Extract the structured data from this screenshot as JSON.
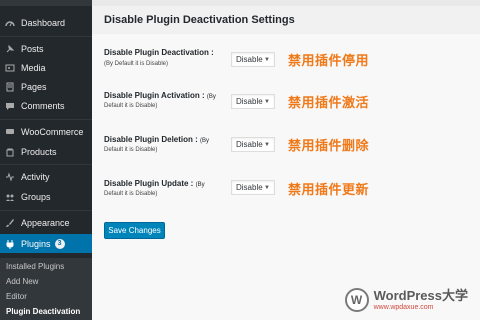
{
  "sidebar": {
    "items": [
      {
        "label": "Dashboard",
        "icon": "dashboard-icon"
      },
      {
        "label": "Posts",
        "icon": "pin-icon"
      },
      {
        "label": "Media",
        "icon": "media-icon"
      },
      {
        "label": "Pages",
        "icon": "page-icon"
      },
      {
        "label": "Comments",
        "icon": "comment-icon"
      },
      {
        "label": "WooCommerce",
        "icon": "woocommerce-icon"
      },
      {
        "label": "Products",
        "icon": "products-icon"
      },
      {
        "label": "Activity",
        "icon": "activity-icon"
      },
      {
        "label": "Groups",
        "icon": "groups-icon"
      },
      {
        "label": "Appearance",
        "icon": "brush-icon"
      },
      {
        "label": "Plugins",
        "icon": "plug-icon",
        "badge": "3"
      }
    ],
    "submenu": [
      {
        "label": "Installed Plugins"
      },
      {
        "label": "Add New"
      },
      {
        "label": "Editor"
      },
      {
        "label": "Plugin Deactivation"
      }
    ]
  },
  "main": {
    "title": "Disable Plugin Deactivation Settings",
    "settings": [
      {
        "label_main": "Disable Plugin Deactivation :",
        "label_note": "(By Default it is Disable)",
        "inline_note": "",
        "value": "Disable",
        "cn_label": "禁用插件停用"
      },
      {
        "label_main": "Disable Plugin Activation :",
        "label_note": "Default it is Disable)",
        "inline_note": "(By",
        "value": "Disable",
        "cn_label": "禁用插件激活"
      },
      {
        "label_main": "Disable Plugin Deletion :",
        "label_note": "Default it is Disable)",
        "inline_note": "(By",
        "value": "Disable",
        "cn_label": "禁用插件删除"
      },
      {
        "label_main": "Disable Plugin Update :",
        "label_note": "Default it is Disable)",
        "inline_note": "(By",
        "value": "Disable",
        "cn_label": "禁用插件更新"
      }
    ],
    "save_label": "Save Changes"
  },
  "watermark": {
    "logo_letter": "W",
    "title": "WordPress大学",
    "url": "www.wpdaxue.com"
  },
  "colors": {
    "sidebar_bg": "#23282d",
    "active_blue": "#0073aa",
    "button_blue": "#0085ba",
    "cn_orange": "#f07a1a"
  }
}
